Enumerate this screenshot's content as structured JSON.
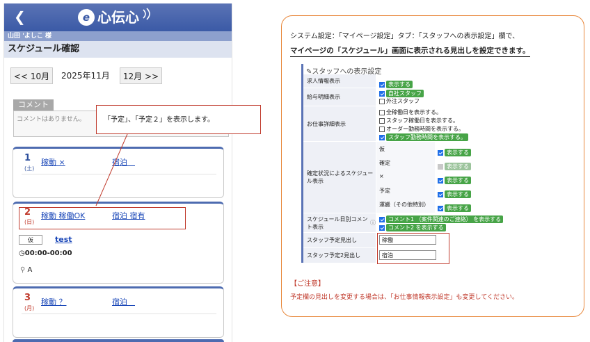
{
  "app": {
    "logo_text": "e心伝心",
    "back_icon": "chevron-left-icon",
    "user_name": "山田 'よしこ 様",
    "page_title": "スケジュール確認"
  },
  "month_nav": {
    "prev_label": "<< 10月",
    "current_label": "2025年11月",
    "next_label": "12月 >>"
  },
  "comment": {
    "tab_label": "コメント",
    "text": "コメントはありません。"
  },
  "days": [
    {
      "day": "1",
      "dow": "(土)",
      "link1": "稼動 ×",
      "link2": "宿泊　"
    },
    {
      "day": "2",
      "dow": "(日)",
      "link1": "稼動 稼働OK",
      "link2": "宿泊 宿有",
      "badge": "仮",
      "entry_name": "test",
      "time": "00:00-00:00",
      "location": "A"
    },
    {
      "day": "3",
      "dow": "(月)",
      "link1": "稼動 ？",
      "link2": "宿泊　"
    }
  ],
  "callout_text": "「予定」、「予定２」を表示します。",
  "panel": {
    "intro": "システム設定：「マイページ設定」タブ：「スタッフへの表示設定」欄で、",
    "intro_bold": "マイページの「スケジュール」画面に表示される見出しを設定できます。",
    "settings_title": "スタッフへの表示設定",
    "rows": {
      "job_info": {
        "label": "求人情報表示",
        "option": "表示する"
      },
      "salary": {
        "label": "給与明細表示",
        "option1": "自社スタッフ",
        "option2": "外注スタッフ"
      },
      "work_detail": {
        "label": "お仕事詳細表示",
        "options": [
          "全稼働日を表示する。",
          "スタッフ稼働日を表示する。",
          "オーダー勤務時間を表示する。",
          "スタッフ勤務時間を表示する。"
        ]
      },
      "status": {
        "label": "確定状況によるスケジュール表示",
        "items": [
          {
            "name": "仮",
            "option": "表示する"
          },
          {
            "name": "確定",
            "option": "表示する"
          },
          {
            "name": "×",
            "option": "表示する"
          },
          {
            "name": "予定",
            "option": "表示する"
          },
          {
            "name": "運搬（その他特別）",
            "option": "表示する"
          }
        ]
      },
      "daily_comment": {
        "label": "スケジュール日別コメント表示",
        "option1": "コメント1 （案件関連のご連絡） を表示する",
        "option2": "コメント2 を表示する"
      },
      "staff_heading1": {
        "label": "スタッフ予定見出し",
        "value": "稼働"
      },
      "staff_heading2": {
        "label": "スタッフ予定2見出し",
        "value": "宿泊"
      }
    },
    "caution_title": "【ご注意】",
    "caution_text": "予定欄の見出しを変更する場合は、「お仕事情報表示設定」も変更してください。"
  },
  "colors": {
    "header_blue": "#3b5aa6",
    "accent_green": "#47a447",
    "highlight_red": "#c0392b",
    "panel_border": "#e8873a"
  }
}
